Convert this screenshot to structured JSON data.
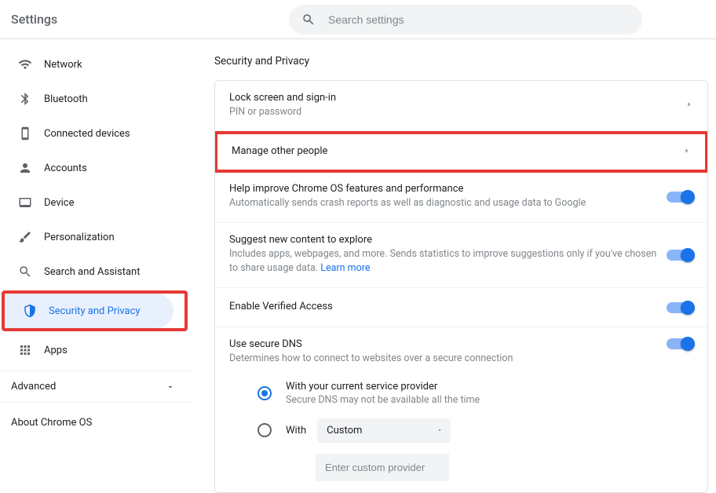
{
  "header": {
    "title": "Settings",
    "search_placeholder": "Search settings"
  },
  "sidebar": {
    "items": [
      {
        "label": "Network"
      },
      {
        "label": "Bluetooth"
      },
      {
        "label": "Connected devices"
      },
      {
        "label": "Accounts"
      },
      {
        "label": "Device"
      },
      {
        "label": "Personalization"
      },
      {
        "label": "Search and Assistant"
      },
      {
        "label": "Security and Privacy"
      },
      {
        "label": "Apps"
      }
    ],
    "advanced": "Advanced",
    "about": "About Chrome OS"
  },
  "main": {
    "section_title": "Security and Privacy",
    "lock": {
      "title": "Lock screen and sign-in",
      "sub": "PIN or password"
    },
    "manage": {
      "title": "Manage other people"
    },
    "improve": {
      "title": "Help improve Chrome OS features and performance",
      "sub": "Automatically sends crash reports as well as diagnostic and usage data to Google"
    },
    "suggest": {
      "title": "Suggest new content to explore",
      "sub": "Includes apps, webpages, and more. Sends statistics to improve suggestions only if you've chosen to share usage data.  ",
      "learn": "Learn more"
    },
    "verified": {
      "title": "Enable Verified Access"
    },
    "dns": {
      "title": "Use secure DNS",
      "sub": "Determines how to connect to websites over a secure connection",
      "opt1": {
        "label": "With your current service provider",
        "sub": "Secure DNS may not be available all the time"
      },
      "opt2": {
        "label": "With",
        "select": "Custom",
        "placeholder": "Enter custom provider"
      }
    }
  }
}
